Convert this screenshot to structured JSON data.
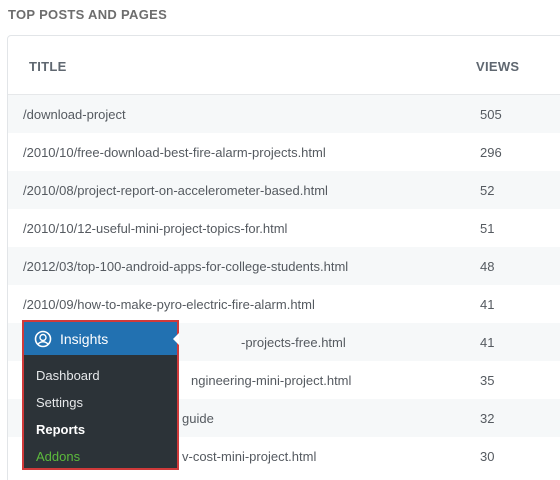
{
  "section": {
    "title": "TOP POSTS AND PAGES"
  },
  "table": {
    "headers": {
      "title": "TITLE",
      "views": "VIEWS"
    },
    "rows": [
      {
        "title": "/download-project",
        "views": "505"
      },
      {
        "title": "/2010/10/free-download-best-fire-alarm-projects.html",
        "views": "296"
      },
      {
        "title": "/2010/08/project-report-on-accelerometer-based.html",
        "views": "52"
      },
      {
        "title": "/2010/10/12-useful-mini-project-topics-for.html",
        "views": "51"
      },
      {
        "title": "/2012/03/top-100-android-apps-for-college-students.html",
        "views": "48"
      },
      {
        "title": "/2010/09/how-to-make-pyro-electric-fire-alarm.html",
        "views": "41"
      },
      {
        "title": "-projects-free.html",
        "views": "41"
      },
      {
        "title": "ngineering-mini-project.html",
        "views": "35"
      },
      {
        "title": "guide",
        "views": "32"
      },
      {
        "title": "v-cost-mini-project.html",
        "views": "30"
      }
    ]
  },
  "wp_menu": {
    "title": "Insights",
    "icon": "insights-icon",
    "items": [
      {
        "label": "Dashboard"
      },
      {
        "label": "Settings"
      },
      {
        "label": "Reports",
        "active": true
      },
      {
        "label": "Addons"
      }
    ]
  },
  "colors": {
    "menu_bg": "#2c3338",
    "menu_header": "#2271b1",
    "highlight_border": "#d03a3a",
    "addons": "#5cba3c"
  }
}
